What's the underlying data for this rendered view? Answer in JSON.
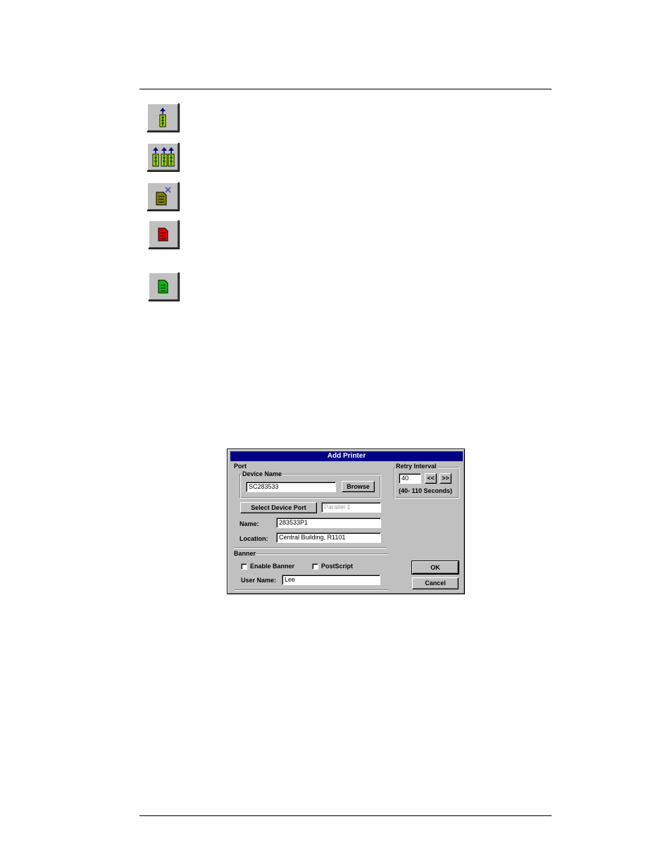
{
  "toolbar_icons": [
    {
      "name": "upload-single-icon"
    },
    {
      "name": "upload-multiple-icon"
    },
    {
      "name": "delete-document-icon"
    },
    {
      "name": "red-document-icon"
    },
    {
      "name": "green-document-icon"
    }
  ],
  "dialog": {
    "title": "Add Printer",
    "port": {
      "label": "Port",
      "device_name_label": "Device Name",
      "device_name_value": "SC283533",
      "browse_label": "Browse",
      "select_device_port_label": "Select Device Port",
      "device_port_value": "Parallel 1",
      "name_label": "Name:",
      "name_value": "283533P1",
      "location_label": "Location:",
      "location_value": "Central Building, R1101"
    },
    "retry": {
      "label": "Retry Interval",
      "value": "40",
      "decrease_label": "<<",
      "increase_label": ">>",
      "range_text": "(40- 110 Seconds)"
    },
    "banner": {
      "label": "Banner",
      "enable_banner_label": "Enable Banner",
      "enable_banner_checked": false,
      "postscript_label": "PostScript",
      "postscript_checked": false,
      "user_name_label": "User Name:",
      "user_name_value": "Lee"
    },
    "ok_label": "OK",
    "cancel_label": "Cancel"
  },
  "colors": {
    "title_bar": "#000080",
    "dialog_face": "#c0c0c0",
    "icon_green": "#00c000",
    "icon_yellow": "#e0e000",
    "icon_red": "#e00000",
    "icon_blue": "#000080"
  }
}
